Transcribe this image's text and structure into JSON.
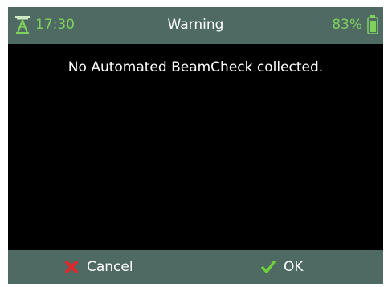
{
  "status_bar": {
    "time": "17:30",
    "title": "Warning",
    "battery_percent": "83%",
    "signal_icon": "tower-signal-icon",
    "battery_icon": "battery-icon",
    "accent_color": "#7fd15d",
    "bar_color": "#4f6a63"
  },
  "message": {
    "text": "No Automated BeamCheck collected."
  },
  "buttons": {
    "cancel": {
      "label": "Cancel",
      "icon": "x-icon",
      "icon_color": "#e0282b"
    },
    "ok": {
      "label": "OK",
      "icon": "checkmark-icon",
      "icon_color": "#6fd03a"
    }
  }
}
